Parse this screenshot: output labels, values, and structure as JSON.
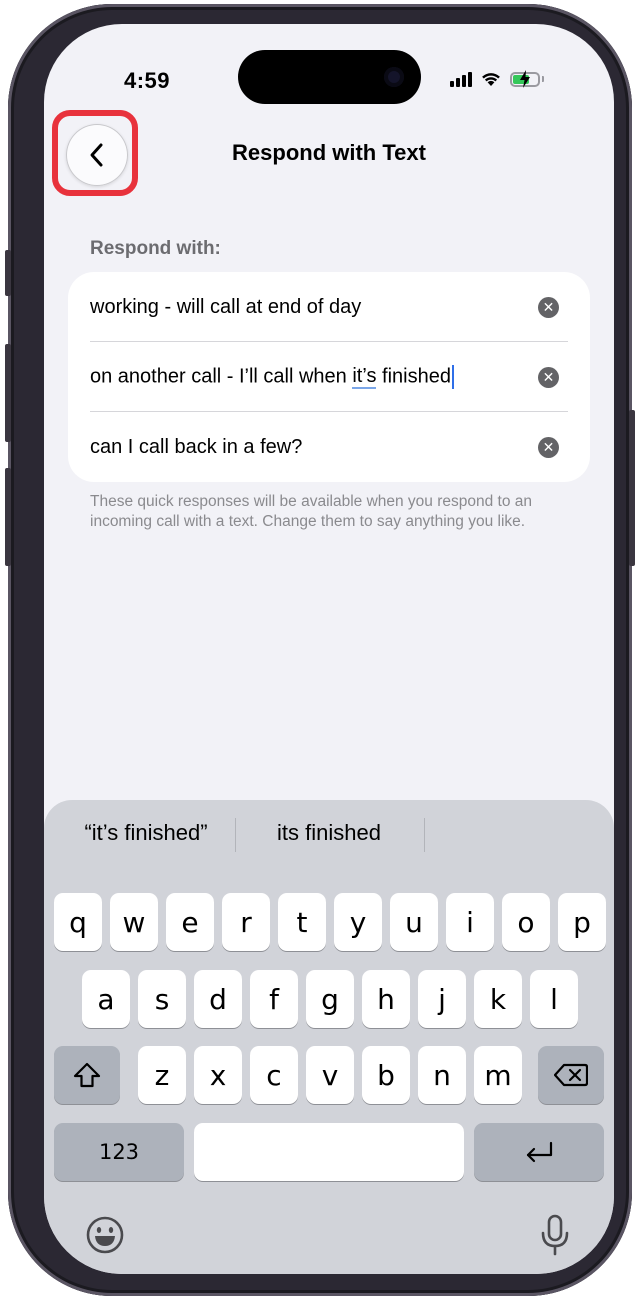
{
  "status_bar": {
    "time": "4:59"
  },
  "nav": {
    "title": "Respond with Text",
    "back_icon": "chevron-left-icon"
  },
  "section_header": "Respond with:",
  "responses": [
    {
      "text": "working - will call at end of day"
    },
    {
      "text_before": "on another call - I’ll call when ",
      "text_underlined": "it’s",
      "text_after": " finished"
    },
    {
      "text": "can I call back in a few?"
    }
  ],
  "footer": "These quick responses will be available when you respond to an incoming call with a text. Change them to say anything you like.",
  "keyboard": {
    "suggestions": [
      "“it’s finished”",
      "its finished"
    ],
    "row1": [
      "q",
      "w",
      "e",
      "r",
      "t",
      "y",
      "u",
      "i",
      "o",
      "p"
    ],
    "row2": [
      "a",
      "s",
      "d",
      "f",
      "g",
      "h",
      "j",
      "k",
      "l"
    ],
    "row3": [
      "z",
      "x",
      "c",
      "v",
      "b",
      "n",
      "m"
    ],
    "numbers_key": "123",
    "icons": {
      "shift": "shift-icon",
      "delete": "delete-icon",
      "return": "return-icon",
      "emoji": "emoji-icon",
      "mic": "microphone-icon"
    }
  },
  "colors": {
    "highlight": "#e8323c",
    "battery": "#34c759",
    "caret": "#2f6fe8"
  }
}
